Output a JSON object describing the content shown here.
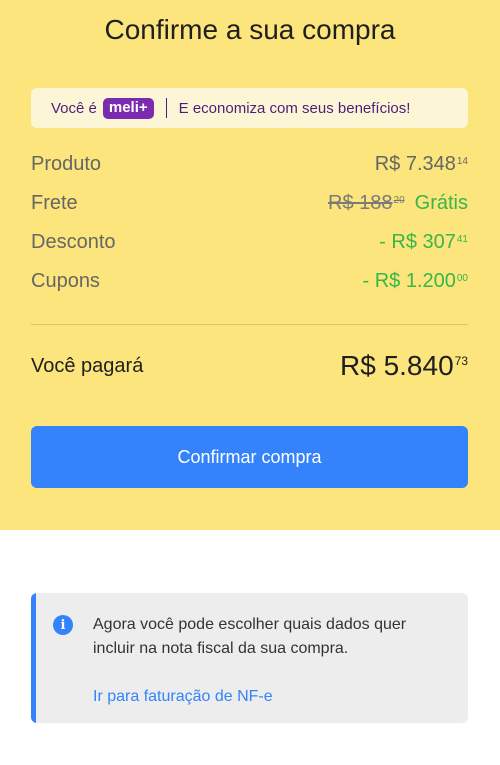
{
  "header": {
    "title": "Confirme a sua compra"
  },
  "meli_banner": {
    "prefix": "Você é",
    "badge": "meli+",
    "message": "E economiza com seus benefícios!"
  },
  "summary": {
    "product": {
      "label": "Produto",
      "amount": "R$ 7.348",
      "cents": "14"
    },
    "shipping": {
      "label": "Frete",
      "original_amount": "R$ 188",
      "original_cents": "20",
      "value": "Grátis"
    },
    "discount": {
      "label": "Desconto",
      "amount": "- R$ 307",
      "cents": "41"
    },
    "coupons": {
      "label": "Cupons",
      "amount": "- R$ 1.200",
      "cents": "00"
    }
  },
  "total": {
    "label": "Você pagará",
    "amount": "R$ 5.840",
    "cents": "73"
  },
  "confirm_button": {
    "label": "Confirmar compra"
  },
  "info_card": {
    "text": "Agora você pode escolher quais dados quer incluir na nota fiscal da sua compra.",
    "link": "Ir para faturação de NF-e"
  },
  "colors": {
    "top_background": "#fbe57c",
    "accent_blue": "#3483fa",
    "green": "#39b54a",
    "meli_purple": "#7a2bb0"
  }
}
